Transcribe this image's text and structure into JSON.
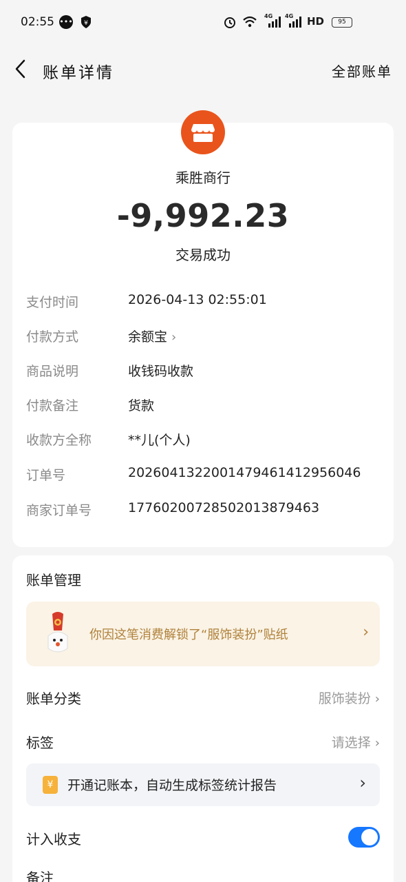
{
  "status_bar": {
    "time": "02:55",
    "network_1": "4G",
    "network_2": "4G",
    "hd_label": "HD",
    "battery": "95"
  },
  "nav": {
    "title": "账单详情",
    "right_link": "全部账单"
  },
  "transaction": {
    "merchant": "乘胜商行",
    "amount": "-9,992.23",
    "status": "交易成功",
    "shop_color": "#e9541c"
  },
  "details": [
    {
      "label": "支付时间",
      "value": "2026-04-13 02:55:01"
    },
    {
      "label": "付款方式",
      "value": "余额宝"
    },
    {
      "label": "商品说明",
      "value": "收钱码收款"
    },
    {
      "label": "付款备注",
      "value": "货款"
    },
    {
      "label": "收款方全称",
      "value": "**儿(个人)"
    },
    {
      "label": "订单号",
      "value": "2026041322001479461412956046"
    },
    {
      "label": "商家订单号",
      "value": "17760200728502013879463"
    }
  ],
  "manage": {
    "title": "账单管理",
    "sticker_text": "你因这笔消费解锁了“服饰装扮”贴纸",
    "category_label": "账单分类",
    "category_value": "服饰装扮",
    "tag_label": "标签",
    "tag_value": "请选择",
    "ledger_text": "开通记账本，自动生成标签统计报告",
    "income_label": "计入收支",
    "income_toggle_on": true,
    "note_label": "备注",
    "accent_color": "#1677ff"
  }
}
